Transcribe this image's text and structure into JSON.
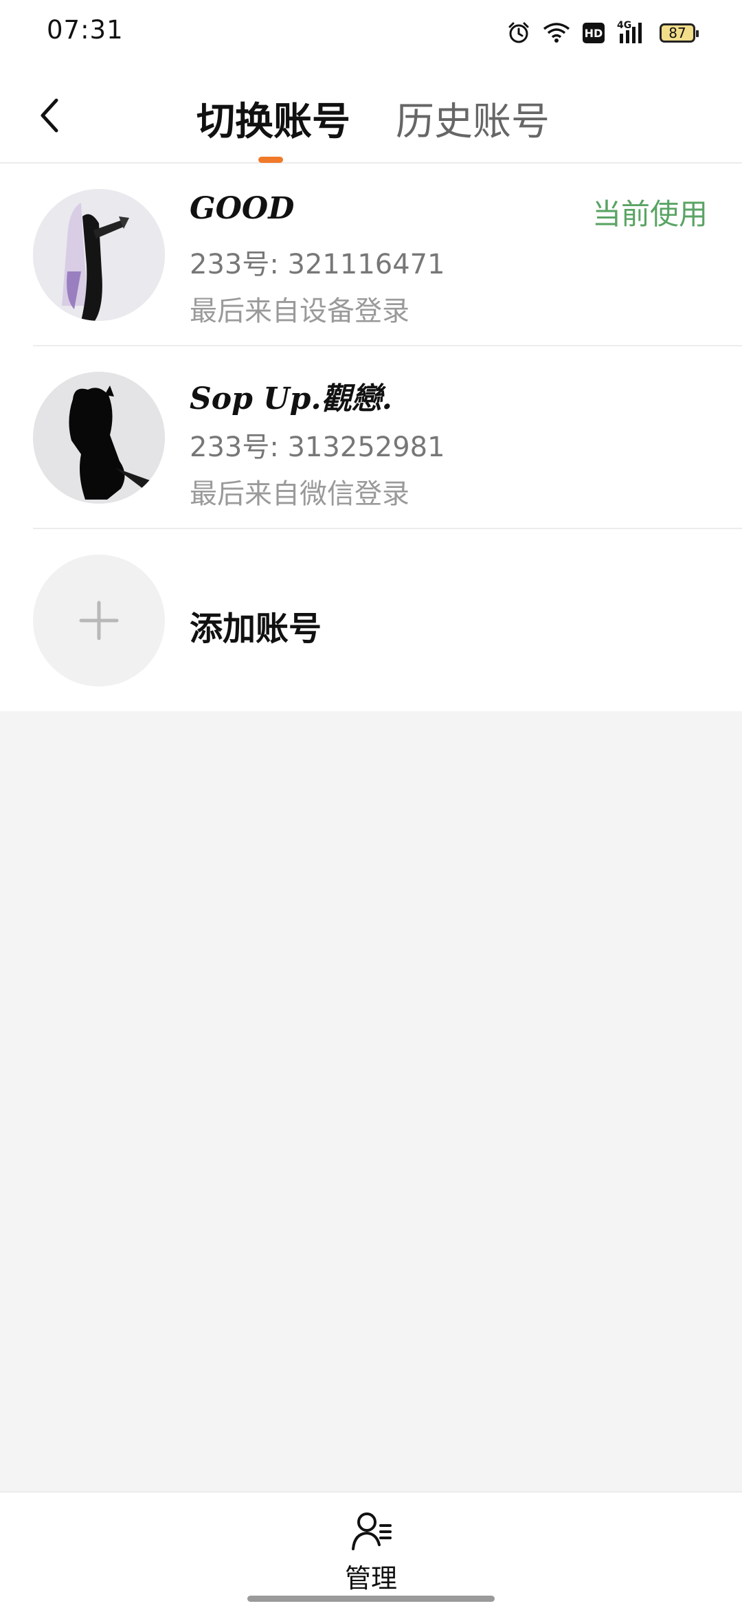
{
  "status_bar": {
    "time": "07:31",
    "battery": "87",
    "network_label": "4G",
    "hd_label": "HD"
  },
  "header": {
    "tabs": [
      {
        "label": "切换账号",
        "active": true
      },
      {
        "label": "历史账号",
        "active": false
      }
    ],
    "indicator_color": "#f07a2a"
  },
  "accounts": [
    {
      "name": "GOOD",
      "uid_text": "233号: 321116471",
      "login_source": "最后来自设备登录",
      "badge": "当前使用"
    },
    {
      "name": "Sop Up.觀戀.",
      "uid_text": "233号: 313252981",
      "login_source": "最后来自微信登录",
      "badge": ""
    }
  ],
  "add_account": {
    "label": "添加账号"
  },
  "bottom": {
    "manage_label": "管理"
  },
  "colors": {
    "accent": "#f07a2a",
    "current_badge": "#5aa464",
    "page_bg": "#f4f4f4"
  }
}
